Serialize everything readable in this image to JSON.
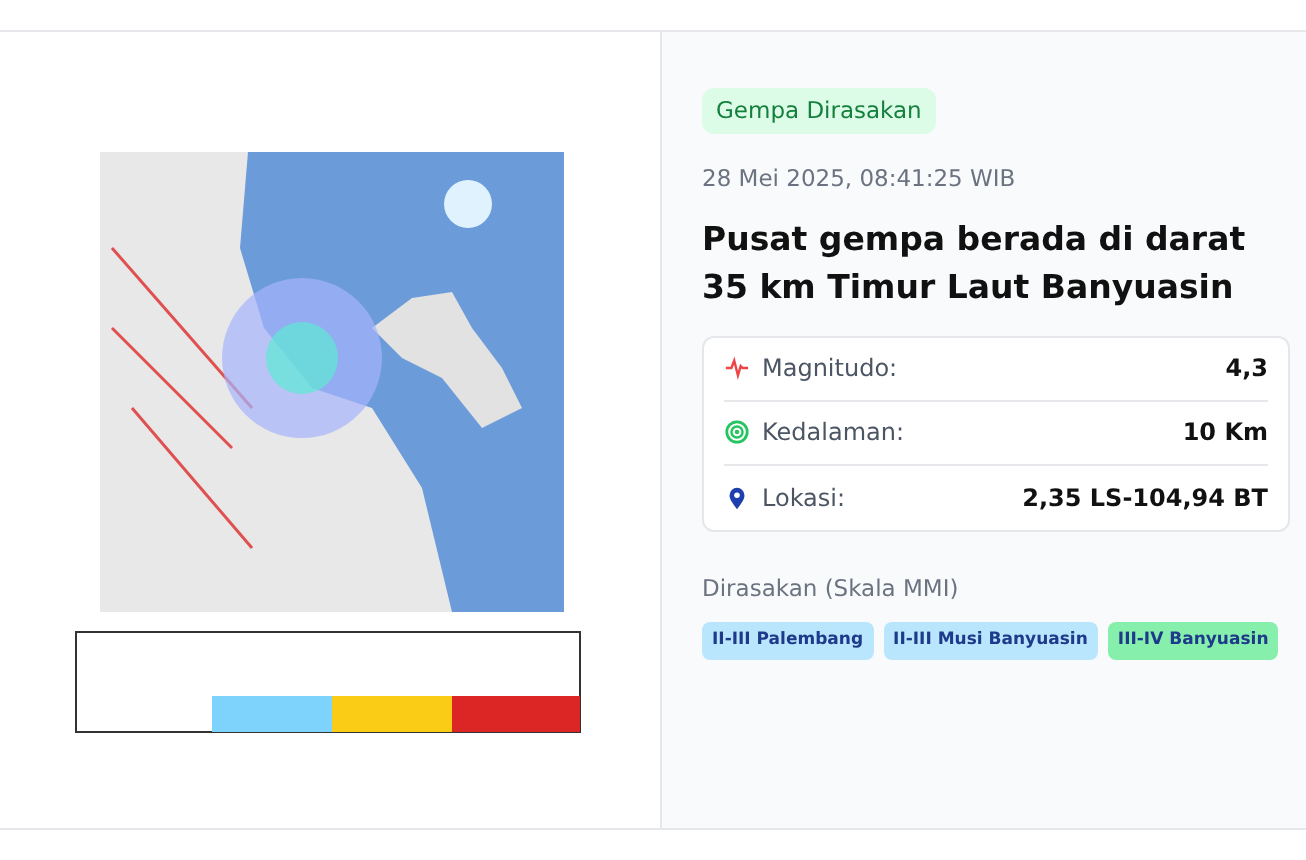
{
  "badge": "Gempa Dirasakan",
  "datetime": "28 Mei 2025, 08:41:25 WIB",
  "headline": "Pusat gempa berada di darat 35 km Timur Laut Banyuasin",
  "details": [
    {
      "kind": "magnitude",
      "label": "Magnitudo:",
      "value": "4,3"
    },
    {
      "kind": "depth",
      "label": "Kedalaman:",
      "value": "10 Km"
    },
    {
      "kind": "location",
      "label": "Lokasi:",
      "value": "2,35 LS-104,94 BT"
    }
  ],
  "felt_heading": "Dirasakan (Skala MMI)",
  "felt_tags": [
    {
      "label": "II-III Palembang",
      "color": "#bae6fd"
    },
    {
      "label": "II-III Musi Banyuasin",
      "color": "#bae6fd"
    },
    {
      "label": "III-IV Banyuasin",
      "color": "#86efac"
    }
  ]
}
